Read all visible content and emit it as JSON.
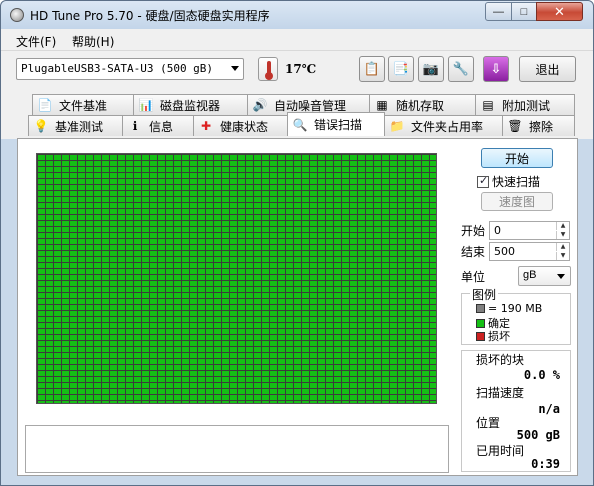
{
  "window": {
    "title": "HD Tune Pro 5.70 - 硬盘/固态硬盘实用程序"
  },
  "title_buttons": {
    "minimize": "—",
    "maximize": "□",
    "close": "✕"
  },
  "menu": [
    {
      "label": "文件(F)"
    },
    {
      "label": "帮助(H)"
    }
  ],
  "toolbar": {
    "drive": "PlugableUSB3-SATA-U3 (500 gB)",
    "temperature": "17℃",
    "exit_label": "退出"
  },
  "tabs_top": [
    {
      "label": "文件基准",
      "icon": "file-benchmark-icon"
    },
    {
      "label": "磁盘监视器",
      "icon": "disk-monitor-icon"
    },
    {
      "label": "自动噪音管理",
      "icon": "speaker-icon"
    },
    {
      "label": "随机存取",
      "icon": "random-access-icon"
    },
    {
      "label": "附加测试",
      "icon": "extra-tests-icon"
    }
  ],
  "tabs_bottom": [
    {
      "label": "基准测试",
      "icon": "benchmark-icon"
    },
    {
      "label": "信息",
      "icon": "info-icon"
    },
    {
      "label": "健康状态",
      "icon": "health-icon"
    },
    {
      "label": "错误扫描",
      "icon": "search-icon",
      "active": true
    },
    {
      "label": "文件夹占用率",
      "icon": "folder-icon"
    },
    {
      "label": "擦除",
      "icon": "trash-icon"
    }
  ],
  "scan": {
    "start_label": "开始",
    "quick_scan_label": "快速扫描",
    "quick_scan_checked": true,
    "speed_map_label": "速度图",
    "start_field_label": "开始",
    "start_value": "0",
    "end_field_label": "结束",
    "end_value": "500",
    "unit_label": "单位",
    "unit_value": "gB",
    "legend": {
      "title": "图例",
      "block_size": "= 190 MB",
      "ok_label": "确定",
      "damaged_label": "损坏"
    },
    "stats": {
      "damaged_blocks_label": "损坏的块",
      "damaged_blocks_value": "0.0 %",
      "scan_speed_label": "扫描速度",
      "scan_speed_value": "n/a",
      "position_label": "位置",
      "position_value": "500 gB",
      "elapsed_label": "已用时间",
      "elapsed_value": "0:39"
    },
    "colors": {
      "ok": "#15c015",
      "damaged": "#cc2222",
      "block": "#808080"
    }
  }
}
